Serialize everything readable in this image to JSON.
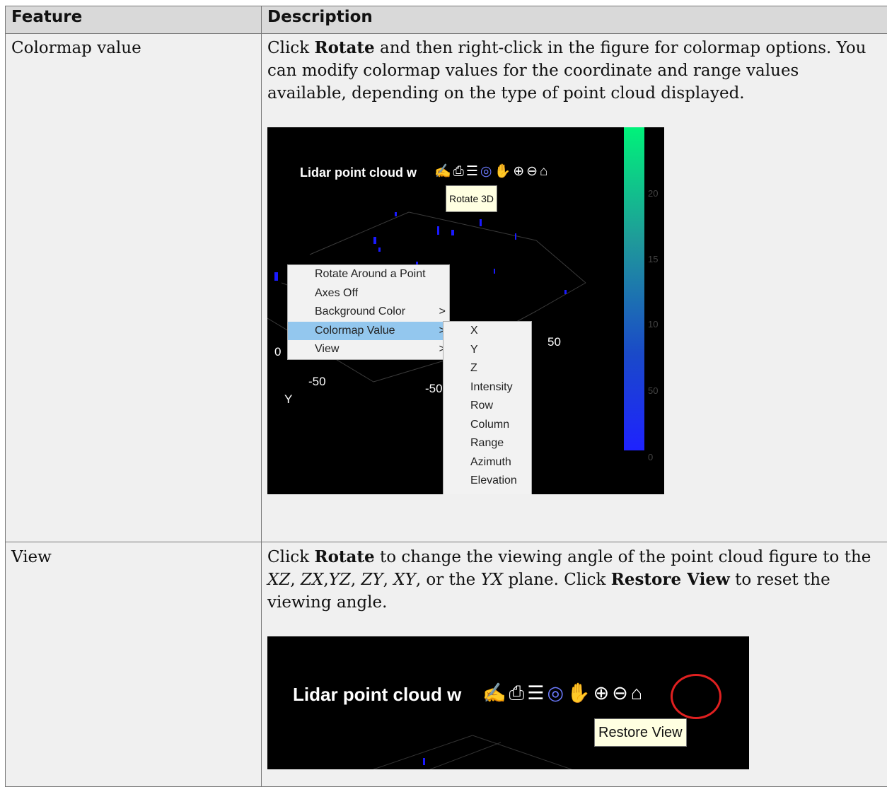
{
  "table": {
    "headers": [
      "Feature",
      "Description"
    ],
    "rows": [
      {
        "feature": "Colormap value",
        "desc_parts": [
          "Click ",
          "Rotate",
          " and then right-click in the figure for colormap options. You can modify colormap values for the coordinate and range values available, depending on the type of point cloud displayed."
        ]
      },
      {
        "feature": "View",
        "desc_parts": [
          "Click ",
          "Rotate",
          " to change the viewing angle of the point cloud figure to the ",
          "XZ",
          ", ",
          "ZX",
          ",",
          "YZ",
          ", ",
          "ZY",
          ", ",
          "XY",
          ", or the ",
          "YX",
          " plane. Click ",
          "Restore View",
          " to reset the viewing angle."
        ]
      }
    ]
  },
  "screenshot1": {
    "title": "Lidar point cloud w",
    "tooltip": "Rotate 3D",
    "menu": [
      {
        "label": "Rotate Around a Point",
        "arrow": ""
      },
      {
        "label": "Axes Off",
        "arrow": ""
      },
      {
        "label": "Background Color",
        "arrow": ">"
      },
      {
        "label": "Colormap Value",
        "arrow": ">"
      },
      {
        "label": "View",
        "arrow": ">"
      }
    ],
    "submenu": [
      "X",
      "Y",
      "Z",
      "Intensity",
      "Row",
      "Column",
      "Range",
      "Azimuth",
      "Elevation"
    ],
    "axis_labels": {
      "zero": "0",
      "neg50_left": "-50",
      "neg50_mid": "-50",
      "pos50": "50",
      "y_axis": "Y"
    },
    "colorbar_ticks": [
      "20",
      "15",
      "10",
      "50",
      "0"
    ],
    "colorbar_colors": {
      "top": "#00f27a",
      "bottom": "#1e22ff"
    },
    "icons": [
      "brush-icon",
      "print-icon",
      "legend-icon",
      "rotate-icon",
      "pan-icon",
      "zoom-in-icon",
      "zoom-out-icon",
      "home-icon"
    ]
  },
  "screenshot2": {
    "title": "Lidar point cloud w",
    "tooltip": "Restore View",
    "highlight_color": "#e02020"
  }
}
